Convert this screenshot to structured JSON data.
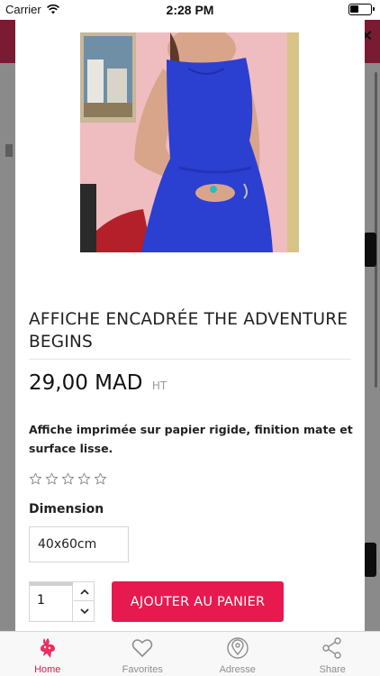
{
  "status_bar": {
    "carrier": "Carrier",
    "time": "2:28 PM",
    "wifi_icon": "wifi-icon",
    "battery_icon": "battery-icon"
  },
  "product": {
    "image_icon": "product-photo-blue-dress",
    "title": "AFFICHE ENCADRÉE THE ADVENTURE BEGINS",
    "price": "29,00 MAD",
    "tax_label": "HT",
    "description": "Affiche imprimée sur papier rigide, finition mate et surface lisse.",
    "rating": {
      "value": 0,
      "max": 5
    },
    "dimension_label": "Dimension",
    "dimension_value": "40x60cm",
    "quantity": "1",
    "add_to_cart_label": "AJOUTER AU PANIER"
  },
  "tab_bar": {
    "items": [
      {
        "label": "Home",
        "icon": "home-icon",
        "active": true
      },
      {
        "label": "Favorites",
        "icon": "heart-icon",
        "active": false
      },
      {
        "label": "Adresse",
        "icon": "location-pin-icon",
        "active": false
      },
      {
        "label": "Share",
        "icon": "share-icon",
        "active": false
      }
    ]
  },
  "colors": {
    "accent": "#e8194f",
    "header_dimmed": "#7a1b33",
    "tab_inactive": "#8e8e8e"
  }
}
